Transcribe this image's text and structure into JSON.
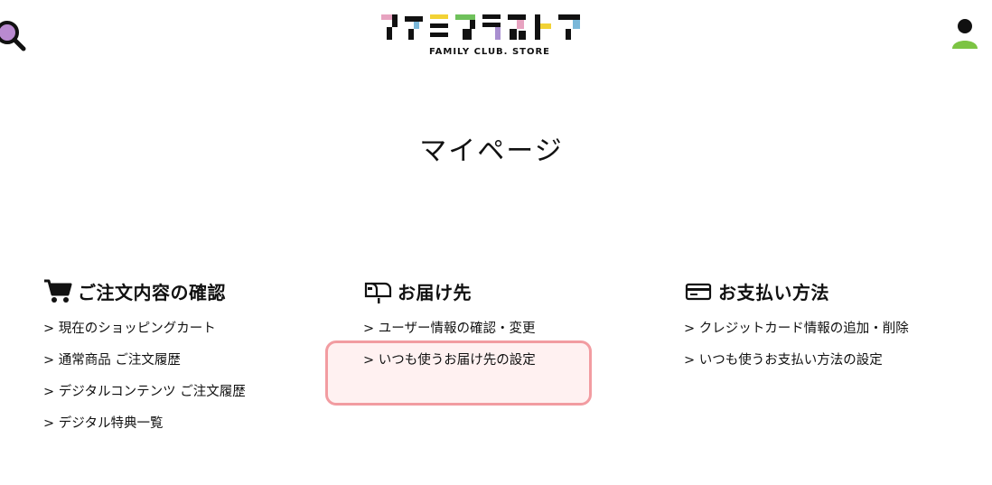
{
  "header": {
    "logo_text": "ファミクラストア",
    "logo_sub": "FAMILY CLUB. STORE",
    "colors": {
      "pink": "#e7a3c0",
      "black": "#111111",
      "blue": "#7bb8d9",
      "yellow": "#f2d235",
      "purple": "#a98fd0",
      "green": "#6fc15b",
      "search": "#b98ad0",
      "user_head": "#111111",
      "user_body": "#7cc443"
    }
  },
  "page": {
    "title": "マイページ"
  },
  "sections": [
    {
      "heading": "ご注文内容の確認",
      "icon": "cart-icon",
      "links": [
        "> 現在のショッピングカート",
        "> 通常商品 ご注文履歴",
        "> デジタルコンテンツ ご注文履歴",
        "> デジタル特典一覧"
      ]
    },
    {
      "heading": "お届け先",
      "icon": "mailbox-icon",
      "links": [
        "> ユーザー情報の確認・変更",
        "> いつも使うお届け先の設定"
      ]
    },
    {
      "heading": "お支払い方法",
      "icon": "credit-card-icon",
      "links": [
        "> クレジットカード情報の追加・削除",
        "> いつも使うお支払い方法の設定"
      ]
    }
  ],
  "highlight_color": "#f29ca1"
}
